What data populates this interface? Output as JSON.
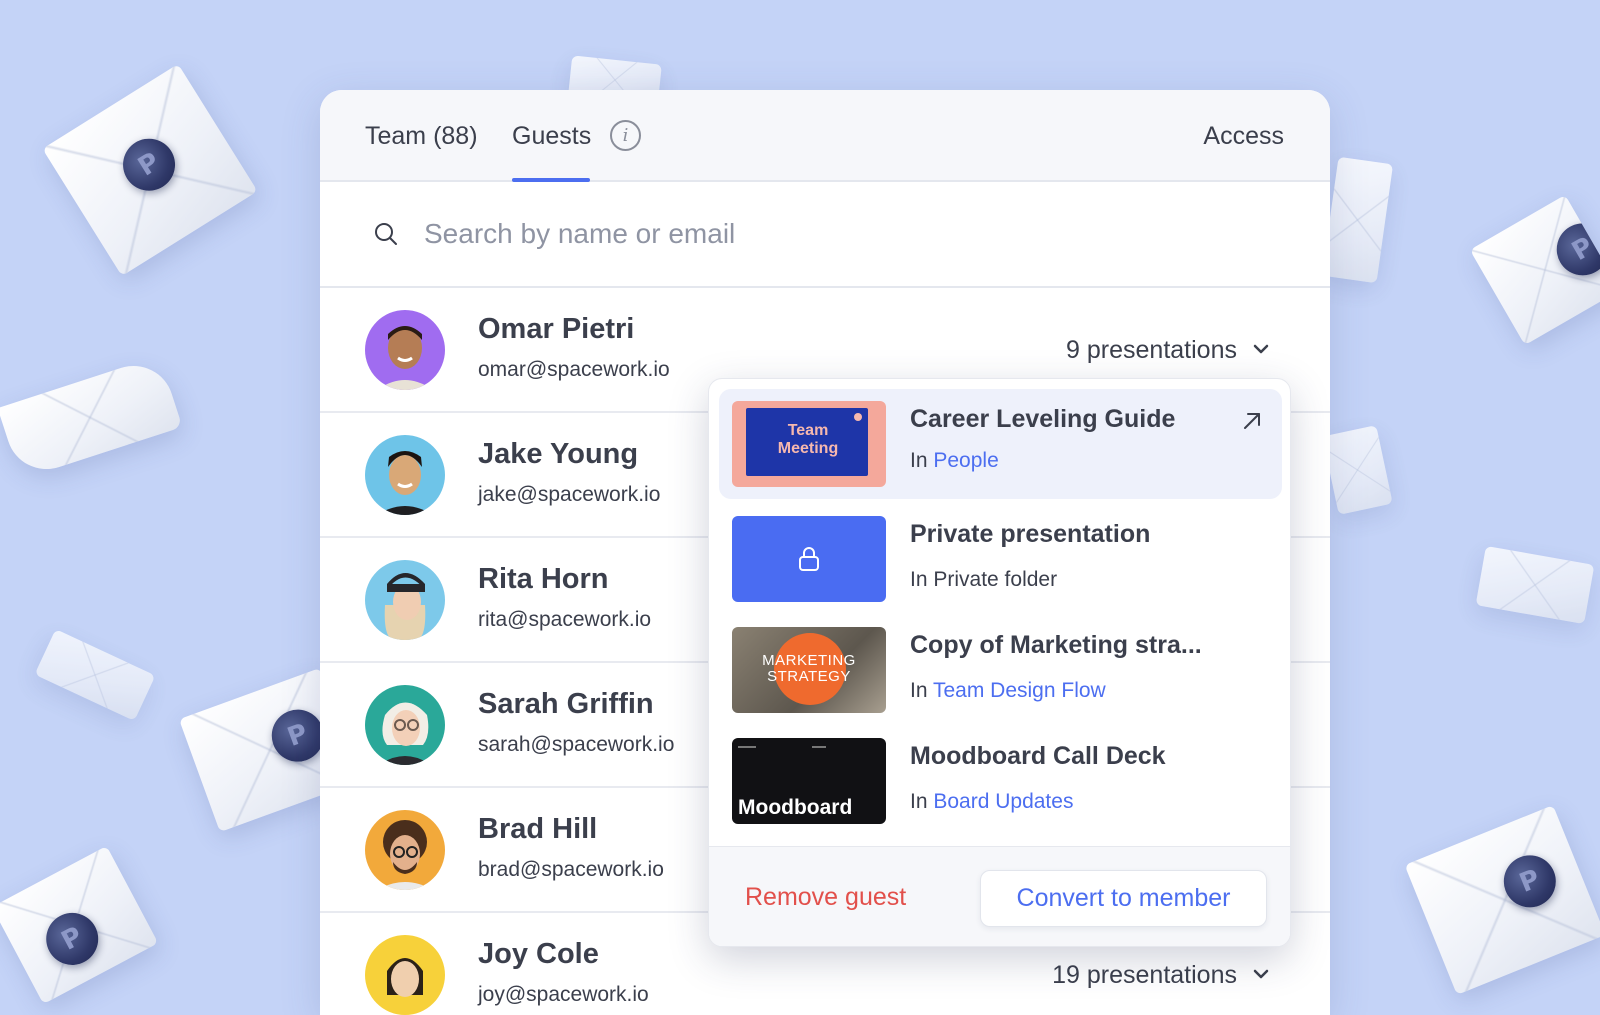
{
  "tabs": {
    "team": "Team (88)",
    "guests": "Guests",
    "access": "Access"
  },
  "search": {
    "placeholder": "Search by name or email",
    "value": ""
  },
  "guests": [
    {
      "name": "Omar Pietri",
      "email": "omar@spacework.io",
      "presentations": "9 presentations",
      "avatar_color": "#a06cf0"
    },
    {
      "name": "Jake Young",
      "email": "jake@spacework.io",
      "avatar_color": "#6ec4e8"
    },
    {
      "name": "Rita Horn",
      "email": "rita@spacework.io",
      "avatar_color": "#7dc9ea"
    },
    {
      "name": "Sarah Griffin",
      "email": "sarah@spacework.io",
      "avatar_color": "#2aa899"
    },
    {
      "name": "Brad Hill",
      "email": "brad@spacework.io",
      "avatar_color": "#f2a93b"
    },
    {
      "name": "Joy Cole",
      "email": "joy@spacework.io",
      "presentations": "19 presentations",
      "avatar_color": "#f7d13a"
    }
  ],
  "dropdown": {
    "items": [
      {
        "title": "Career Leveling Guide",
        "prefix": "In",
        "location": "People",
        "thumb_text": "Team Meeting"
      },
      {
        "title": "Private presentation",
        "prefix": "In",
        "location": "Private folder"
      },
      {
        "title": "Copy of Marketing stra...",
        "prefix": "In",
        "location": "Team Design Flow",
        "thumb_text": "MARKETING STRATEGY"
      },
      {
        "title": "Moodboard Call Deck",
        "prefix": "In",
        "location": "Board Updates",
        "thumb_text": "Moodboard"
      }
    ],
    "remove_label": "Remove guest",
    "convert_label": "Convert to member"
  },
  "colors": {
    "accent": "#4c6ef0",
    "danger": "#e2504b",
    "background": "#c4d3f7"
  }
}
